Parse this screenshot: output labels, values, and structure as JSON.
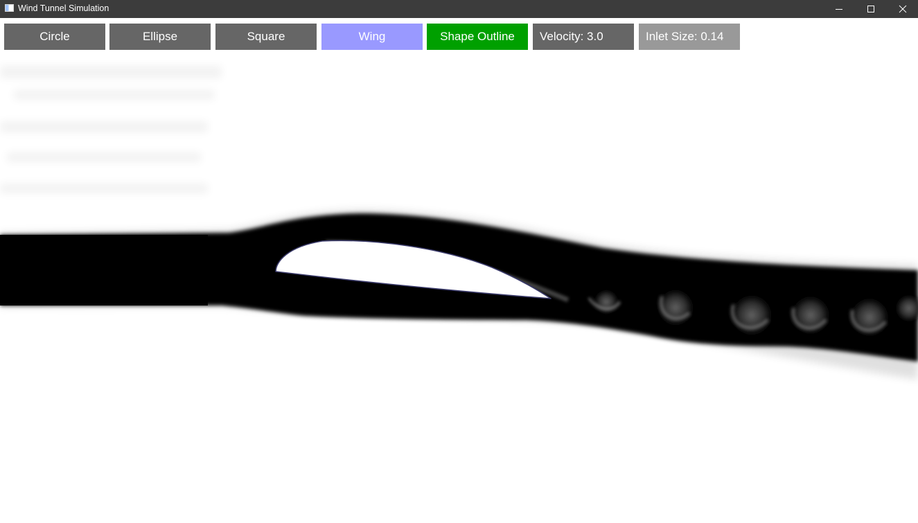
{
  "window": {
    "title": "Wind Tunnel Simulation",
    "icons": {
      "app": "app-icon",
      "minimize": "minimize-icon",
      "maximize": "maximize-icon",
      "close": "close-icon"
    }
  },
  "toolbar": {
    "circle_label": "Circle",
    "ellipse_label": "Ellipse",
    "square_label": "Square",
    "wing_label": "Wing",
    "shape_outline_label": "Shape Outline",
    "velocity_label": "Velocity: 3.0",
    "inlet_size_label": "Inlet Size: 0.14",
    "selected_shape": "Wing"
  },
  "simulation": {
    "velocity": 3.0,
    "inlet_size": 0.14,
    "shape": "wing",
    "shape_outline_enabled": true
  },
  "colors": {
    "titlebar": "#3c3c3c",
    "button_default": "#666666",
    "button_selected": "#9999ff",
    "button_outline_on": "#00a000",
    "button_inlet": "#999999",
    "smoke": "#000000",
    "outline": "#3a3a6a"
  }
}
